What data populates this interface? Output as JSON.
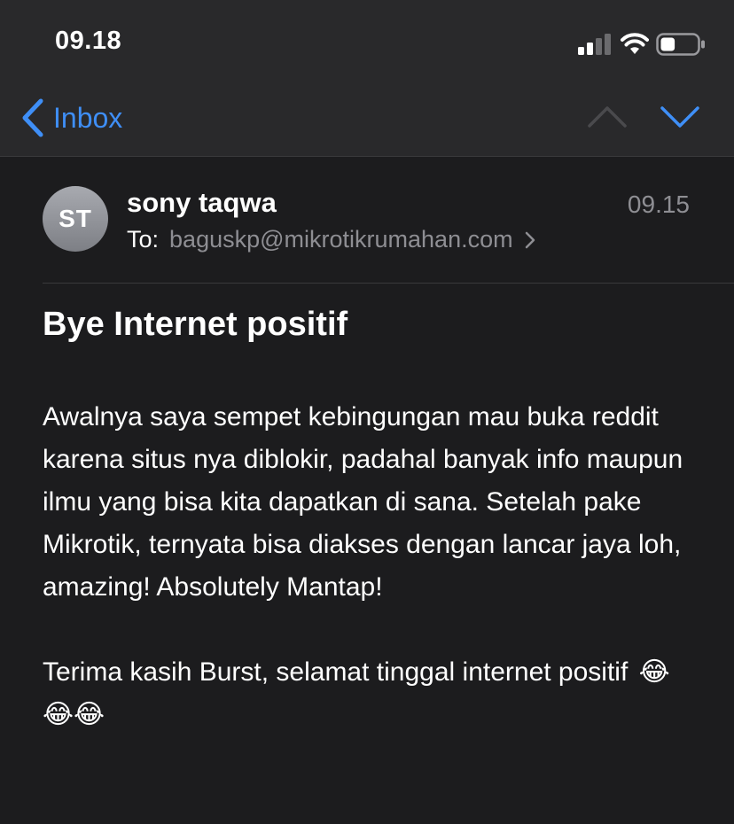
{
  "status_bar": {
    "time": "09.18",
    "signal_icon": "signal-bars-icon",
    "wifi_icon": "wifi-icon",
    "battery_icon": "battery-icon",
    "battery_level": 0.4
  },
  "nav": {
    "back_label": "Inbox",
    "back_icon": "chevron-left-icon",
    "prev_icon": "chevron-up-icon",
    "next_icon": "chevron-down-icon",
    "accent_color": "#3f8ff7"
  },
  "message": {
    "avatar_initials": "ST",
    "sender": "sony taqwa",
    "time": "09.15",
    "to_label": "To:",
    "recipient": "baguskp@mikrotikrumahan.com",
    "subject": "Bye Internet positif",
    "body": {
      "paragraph_1": "Awalnya saya sempet kebingungan mau buka reddit karena situs nya diblokir, padahal banyak info maupun ilmu yang bisa kita dapatkan di sana. Setelah pake Mikrotik, ternyata bisa diakses dengan lancar jaya loh, amazing! Absolutely Mantap!",
      "paragraph_2": "Terima kasih Burst, selamat tinggal internet positif",
      "emojis": "😂😂😂"
    }
  }
}
